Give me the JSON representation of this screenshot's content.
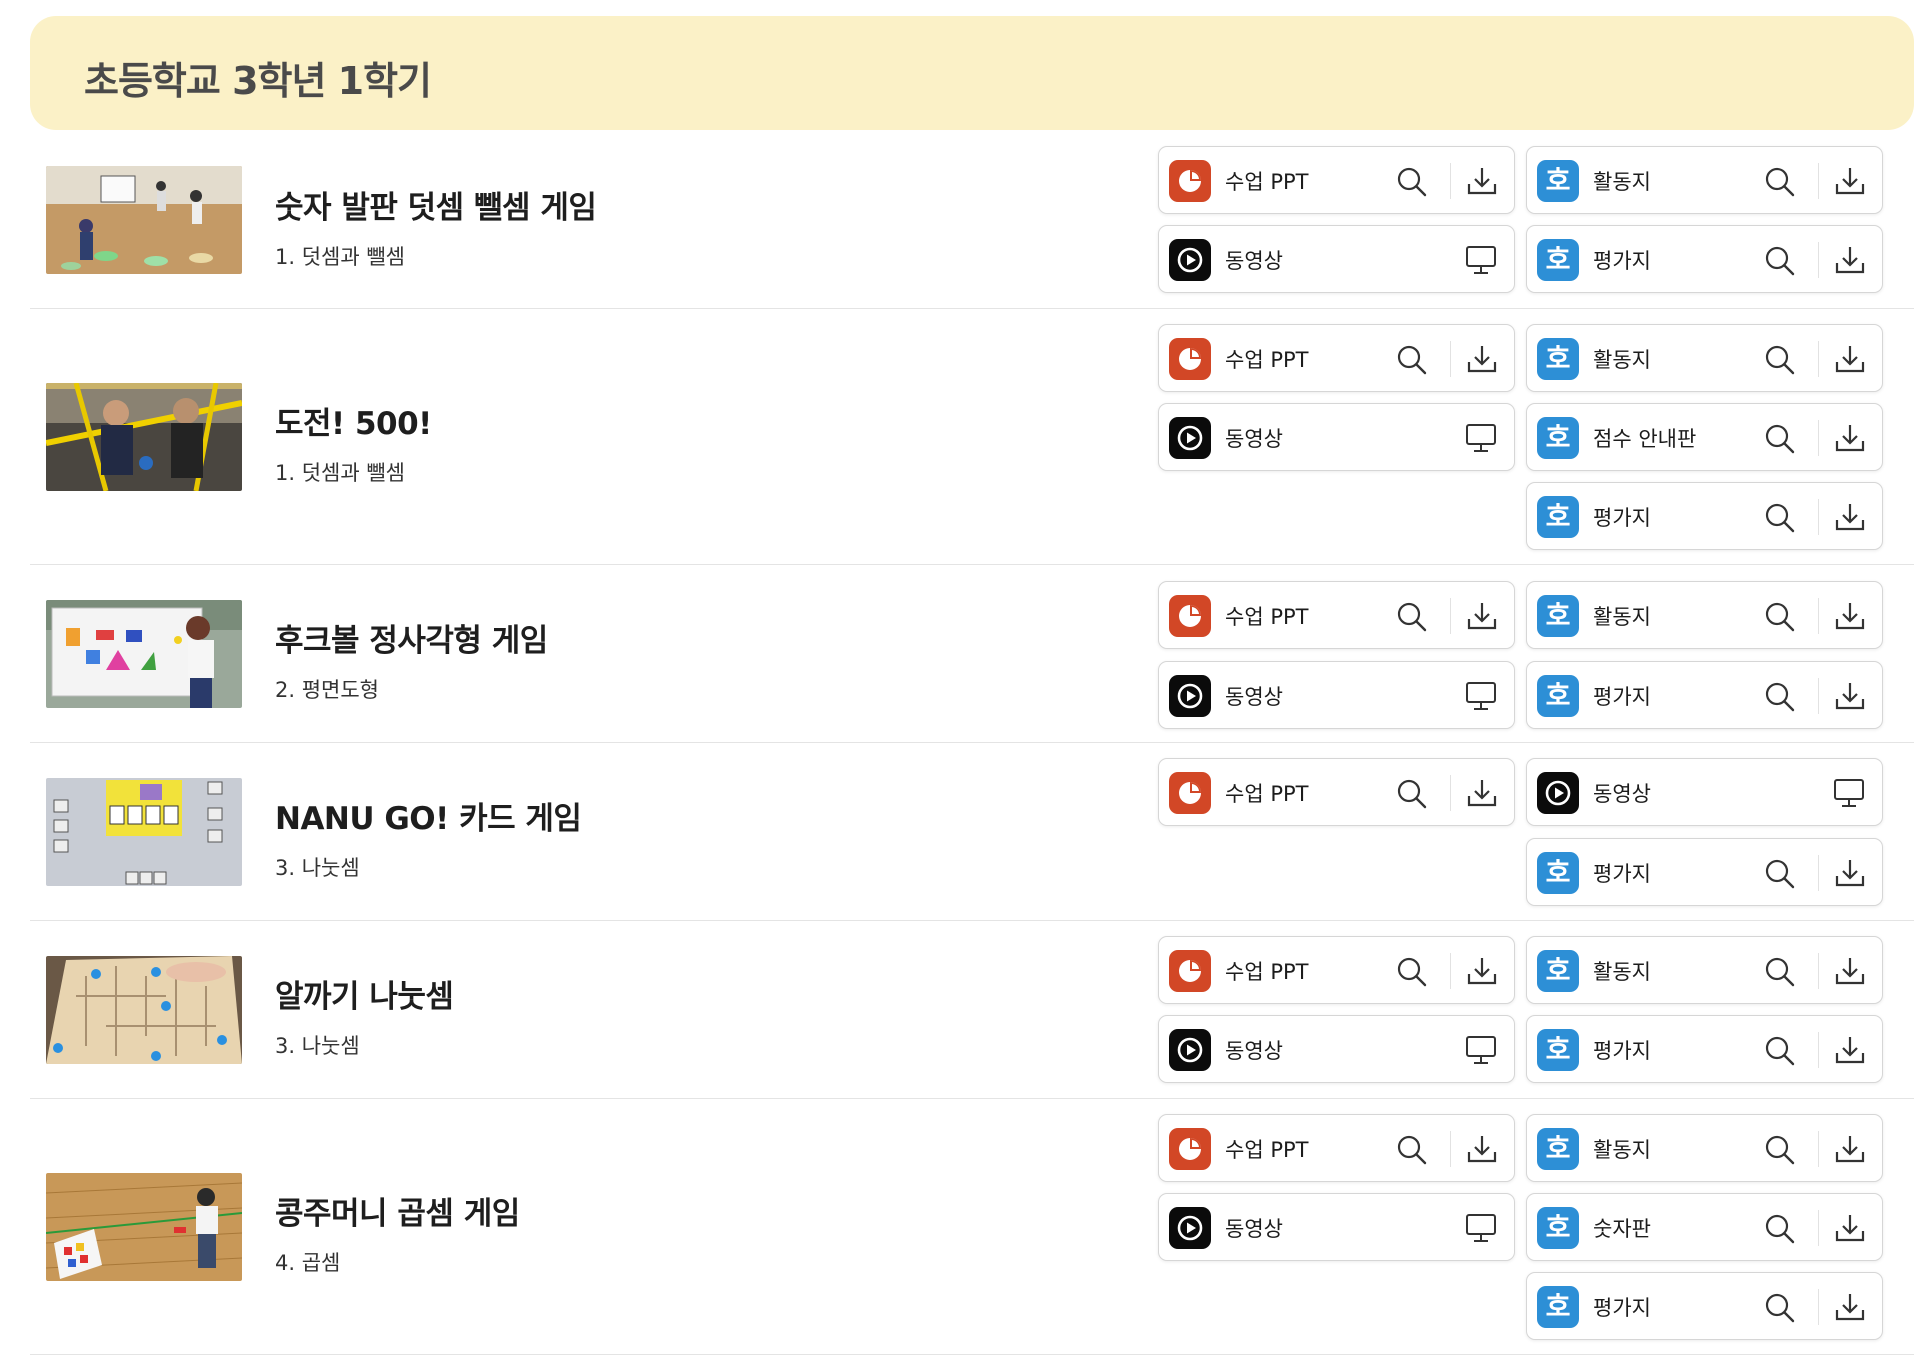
{
  "header": {
    "title": "초등학교 3학년 1학기"
  },
  "labels": {
    "ppt": "수업 PPT",
    "video": "동영상",
    "activity": "활동지",
    "eval": "평가지",
    "score": "점수 안내판",
    "numboard": "숫자판"
  },
  "icons": {
    "ppt": "powerpoint-icon",
    "video": "play-icon",
    "doc": "hwp-document-icon",
    "preview": "search-icon",
    "download": "download-icon",
    "watch": "monitor-icon"
  },
  "colors": {
    "header_bg": "#fbf1c7",
    "ppt": "#d24726",
    "hwp": "#2d8fd6",
    "video": "#0b0b0b"
  },
  "lessons": [
    {
      "title": "숫자 발판 덧셈 뺄셈 게임",
      "unit": "1. 덧셈과 뺄셈"
    },
    {
      "title": "도전! 500!",
      "unit": "1. 덧셈과 뺄셈"
    },
    {
      "title": "후크볼 정사각형 게임",
      "unit": "2. 평면도형"
    },
    {
      "title": "NANU GO! 카드 게임",
      "unit": "3. 나눗셈"
    },
    {
      "title": "알까기 나눗셈",
      "unit": "3. 나눗셈"
    },
    {
      "title": "콩주머니 곱셈 게임",
      "unit": "4. 곱셈"
    }
  ]
}
